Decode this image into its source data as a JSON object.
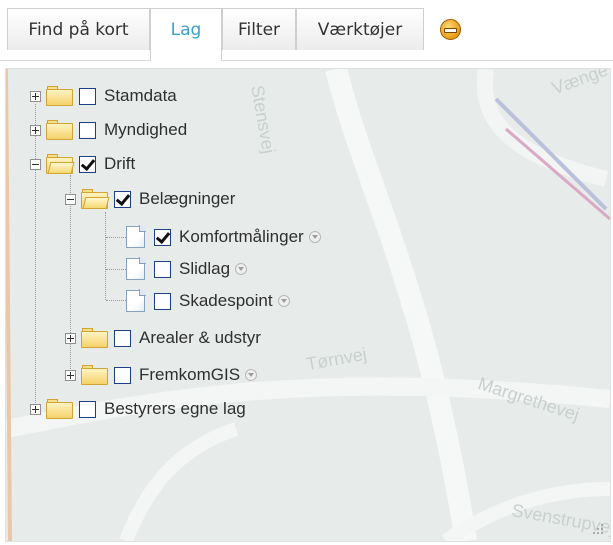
{
  "tabs": [
    {
      "label": "Find på kort"
    },
    {
      "label": "Lag"
    },
    {
      "label": "Filter"
    },
    {
      "label": "Værktøjer"
    }
  ],
  "colors": {
    "active_tab": "#3aa2c7",
    "map_bg": "#e7ecea",
    "collapse_icon": "#e89b13"
  },
  "icons": {
    "collapse": "collapse-minus-icon",
    "folder": "folder-icon",
    "document": "document-icon",
    "info": "info-icon"
  },
  "map": {
    "labels": [
      "Vænge",
      "Stensvej",
      "Tørnvej",
      "Margrethevej",
      "Svenstrupvej"
    ]
  },
  "tree": {
    "stamdata": {
      "label": "Stamdata",
      "checked": false,
      "expanded": false
    },
    "myndighed": {
      "label": "Myndighed",
      "checked": false,
      "expanded": false
    },
    "drift": {
      "label": "Drift",
      "checked": true,
      "expanded": true,
      "belaegninger": {
        "label": "Belægninger",
        "checked": true,
        "expanded": true,
        "komfortmaalinger": {
          "label": "Komfortmålinger",
          "checked": true
        },
        "slidlag": {
          "label": "Slidlag",
          "checked": false
        },
        "skadespoint": {
          "label": "Skadespoint",
          "checked": false
        }
      },
      "arealer": {
        "label": "Arealer & udstyr",
        "checked": false,
        "expanded": false
      },
      "fremkomgis": {
        "label": "FremkomGIS",
        "checked": false,
        "expanded": false
      }
    },
    "bestyrer": {
      "label": "Bestyrers egne lag",
      "checked": false,
      "expanded": false
    }
  }
}
